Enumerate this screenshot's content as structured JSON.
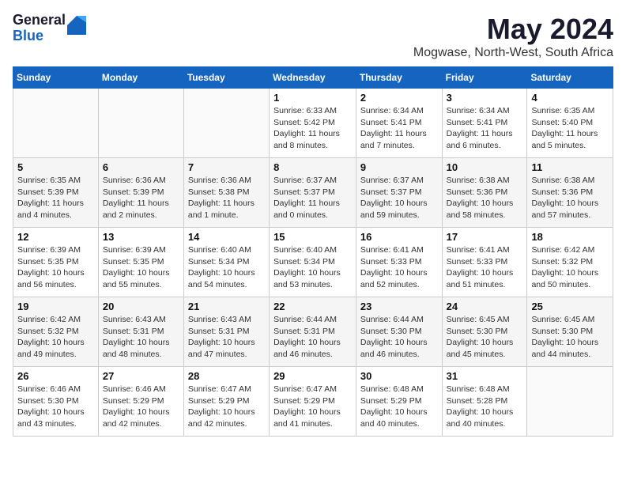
{
  "header": {
    "logo_general": "General",
    "logo_blue": "Blue",
    "month": "May 2024",
    "location": "Mogwase, North-West, South Africa"
  },
  "weekdays": [
    "Sunday",
    "Monday",
    "Tuesday",
    "Wednesday",
    "Thursday",
    "Friday",
    "Saturday"
  ],
  "weeks": [
    [
      {
        "day": "",
        "info": ""
      },
      {
        "day": "",
        "info": ""
      },
      {
        "day": "",
        "info": ""
      },
      {
        "day": "1",
        "info": "Sunrise: 6:33 AM\nSunset: 5:42 PM\nDaylight: 11 hours\nand 8 minutes."
      },
      {
        "day": "2",
        "info": "Sunrise: 6:34 AM\nSunset: 5:41 PM\nDaylight: 11 hours\nand 7 minutes."
      },
      {
        "day": "3",
        "info": "Sunrise: 6:34 AM\nSunset: 5:41 PM\nDaylight: 11 hours\nand 6 minutes."
      },
      {
        "day": "4",
        "info": "Sunrise: 6:35 AM\nSunset: 5:40 PM\nDaylight: 11 hours\nand 5 minutes."
      }
    ],
    [
      {
        "day": "5",
        "info": "Sunrise: 6:35 AM\nSunset: 5:39 PM\nDaylight: 11 hours\nand 4 minutes."
      },
      {
        "day": "6",
        "info": "Sunrise: 6:36 AM\nSunset: 5:39 PM\nDaylight: 11 hours\nand 2 minutes."
      },
      {
        "day": "7",
        "info": "Sunrise: 6:36 AM\nSunset: 5:38 PM\nDaylight: 11 hours\nand 1 minute."
      },
      {
        "day": "8",
        "info": "Sunrise: 6:37 AM\nSunset: 5:37 PM\nDaylight: 11 hours\nand 0 minutes."
      },
      {
        "day": "9",
        "info": "Sunrise: 6:37 AM\nSunset: 5:37 PM\nDaylight: 10 hours\nand 59 minutes."
      },
      {
        "day": "10",
        "info": "Sunrise: 6:38 AM\nSunset: 5:36 PM\nDaylight: 10 hours\nand 58 minutes."
      },
      {
        "day": "11",
        "info": "Sunrise: 6:38 AM\nSunset: 5:36 PM\nDaylight: 10 hours\nand 57 minutes."
      }
    ],
    [
      {
        "day": "12",
        "info": "Sunrise: 6:39 AM\nSunset: 5:35 PM\nDaylight: 10 hours\nand 56 minutes."
      },
      {
        "day": "13",
        "info": "Sunrise: 6:39 AM\nSunset: 5:35 PM\nDaylight: 10 hours\nand 55 minutes."
      },
      {
        "day": "14",
        "info": "Sunrise: 6:40 AM\nSunset: 5:34 PM\nDaylight: 10 hours\nand 54 minutes."
      },
      {
        "day": "15",
        "info": "Sunrise: 6:40 AM\nSunset: 5:34 PM\nDaylight: 10 hours\nand 53 minutes."
      },
      {
        "day": "16",
        "info": "Sunrise: 6:41 AM\nSunset: 5:33 PM\nDaylight: 10 hours\nand 52 minutes."
      },
      {
        "day": "17",
        "info": "Sunrise: 6:41 AM\nSunset: 5:33 PM\nDaylight: 10 hours\nand 51 minutes."
      },
      {
        "day": "18",
        "info": "Sunrise: 6:42 AM\nSunset: 5:32 PM\nDaylight: 10 hours\nand 50 minutes."
      }
    ],
    [
      {
        "day": "19",
        "info": "Sunrise: 6:42 AM\nSunset: 5:32 PM\nDaylight: 10 hours\nand 49 minutes."
      },
      {
        "day": "20",
        "info": "Sunrise: 6:43 AM\nSunset: 5:31 PM\nDaylight: 10 hours\nand 48 minutes."
      },
      {
        "day": "21",
        "info": "Sunrise: 6:43 AM\nSunset: 5:31 PM\nDaylight: 10 hours\nand 47 minutes."
      },
      {
        "day": "22",
        "info": "Sunrise: 6:44 AM\nSunset: 5:31 PM\nDaylight: 10 hours\nand 46 minutes."
      },
      {
        "day": "23",
        "info": "Sunrise: 6:44 AM\nSunset: 5:30 PM\nDaylight: 10 hours\nand 46 minutes."
      },
      {
        "day": "24",
        "info": "Sunrise: 6:45 AM\nSunset: 5:30 PM\nDaylight: 10 hours\nand 45 minutes."
      },
      {
        "day": "25",
        "info": "Sunrise: 6:45 AM\nSunset: 5:30 PM\nDaylight: 10 hours\nand 44 minutes."
      }
    ],
    [
      {
        "day": "26",
        "info": "Sunrise: 6:46 AM\nSunset: 5:30 PM\nDaylight: 10 hours\nand 43 minutes."
      },
      {
        "day": "27",
        "info": "Sunrise: 6:46 AM\nSunset: 5:29 PM\nDaylight: 10 hours\nand 42 minutes."
      },
      {
        "day": "28",
        "info": "Sunrise: 6:47 AM\nSunset: 5:29 PM\nDaylight: 10 hours\nand 42 minutes."
      },
      {
        "day": "29",
        "info": "Sunrise: 6:47 AM\nSunset: 5:29 PM\nDaylight: 10 hours\nand 41 minutes."
      },
      {
        "day": "30",
        "info": "Sunrise: 6:48 AM\nSunset: 5:29 PM\nDaylight: 10 hours\nand 40 minutes."
      },
      {
        "day": "31",
        "info": "Sunrise: 6:48 AM\nSunset: 5:28 PM\nDaylight: 10 hours\nand 40 minutes."
      },
      {
        "day": "",
        "info": ""
      }
    ]
  ]
}
